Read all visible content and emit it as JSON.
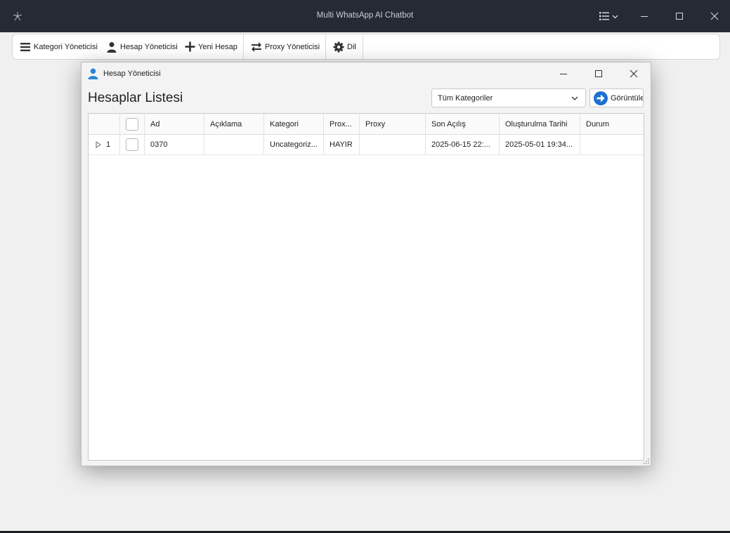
{
  "window": {
    "title": "Multi WhatsApp AI Chatbot"
  },
  "toolbar": {
    "category_manager": "Kategori Yöneticisi",
    "account_manager": "Hesap Yöneticisi",
    "new_account": "Yeni Hesap",
    "proxy_manager": "Proxy Yöneticisi",
    "language": "Dil"
  },
  "dialog": {
    "title": "Hesap Yöneticisi",
    "heading": "Hesaplar Listesi",
    "category_select": "Tüm Kategoriler",
    "view_button": "Görüntüle"
  },
  "table": {
    "columns": [
      "Ad",
      "Açıklama",
      "Kategori",
      "Prox...",
      "Proxy",
      "Son Açılış",
      "Oluşturulma Tarihi",
      "Durum"
    ],
    "rows": [
      {
        "index": "1",
        "ad": "0370",
        "aciklama": "",
        "kategori": "Uncategoriz...",
        "proxy_enabled": "HAYIR",
        "proxy": "",
        "son_acilis": "2025-06-15 22:...",
        "olusturulma": "2025-05-01 19:34...",
        "durum": ""
      }
    ]
  },
  "colors": {
    "titlebar": "#262a35",
    "accent": "#1e6fd2"
  }
}
